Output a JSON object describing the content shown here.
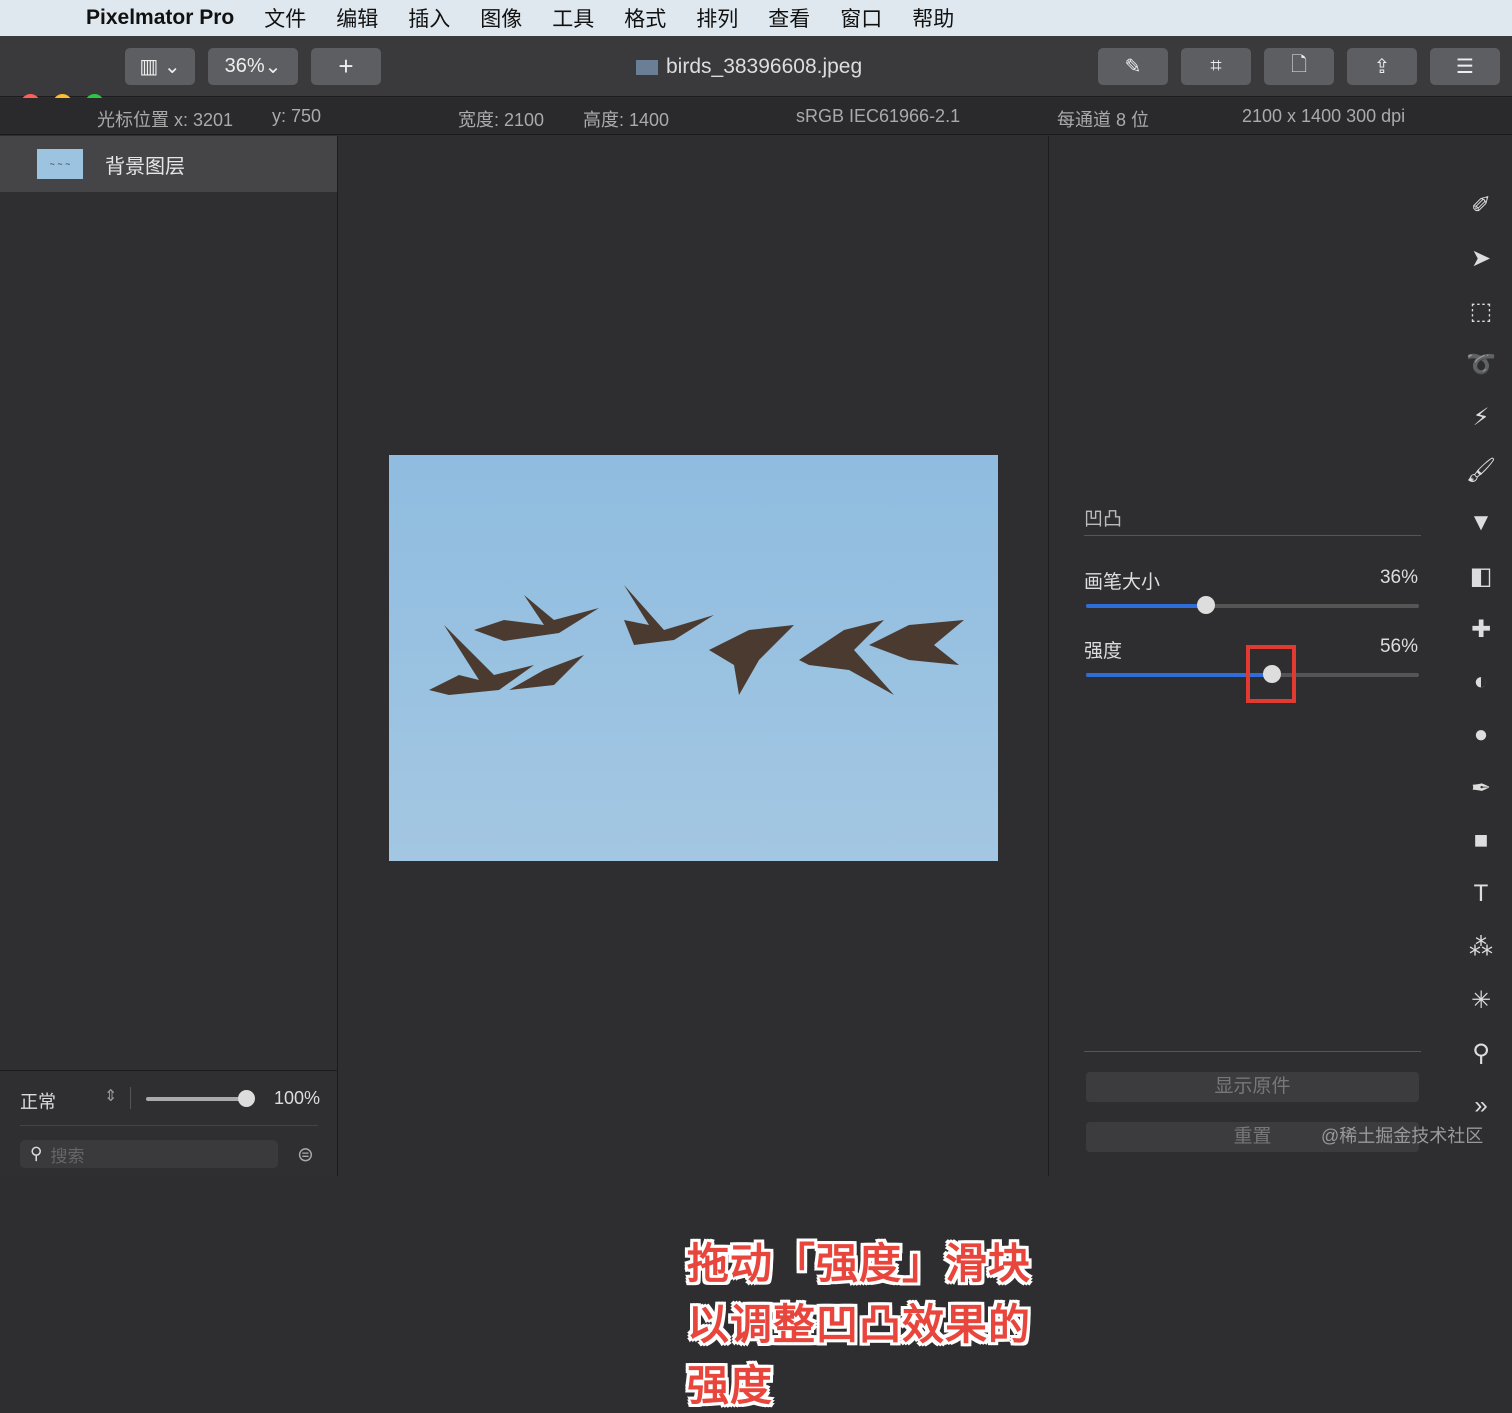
{
  "menubar": {
    "app": "Pixelmator Pro",
    "items": [
      "文件",
      "编辑",
      "插入",
      "图像",
      "工具",
      "格式",
      "排列",
      "查看",
      "窗口",
      "帮助"
    ]
  },
  "toolbar": {
    "zoom": "36%",
    "add": "+",
    "document_title": "birds_38396608.jpeg",
    "traffic_colors": [
      "#fe5f57",
      "#febc2e",
      "#28c840"
    ]
  },
  "infobar": {
    "cursor_label": "光标位置 x: 3201",
    "cursor_y": "y: 750",
    "width": "宽度: 2100",
    "height": "高度: 1400",
    "color_profile": "sRGB IEC61966-2.1",
    "bit_depth": "每通道 8 位",
    "dimensions": "2100 x 1400 300 dpi"
  },
  "layers": {
    "items": [
      {
        "name": "背景图层"
      }
    ],
    "blend_mode": "正常",
    "opacity": "100%",
    "opacity_value": 100,
    "search_placeholder": "搜索"
  },
  "effect": {
    "title": "凹凸",
    "brush_size_label": "画笔大小",
    "brush_size": "36%",
    "brush_size_value": 36,
    "strength_label": "强度",
    "strength": "56%",
    "strength_value": 56,
    "show_original": "显示原件",
    "reset": "重置",
    "accent": "#2f6ed8",
    "highlight": "#e03a32"
  },
  "tools": [
    "paint-bucket-style",
    "arrow",
    "selection",
    "lasso",
    "magic-wand",
    "brush",
    "fill",
    "eraser",
    "repair",
    "clone",
    "blur",
    "pen",
    "shape",
    "text",
    "color-adjust",
    "distort",
    "zoom",
    "more"
  ],
  "caption": "拖动「强度」滑块以调整凹凸效果的强度",
  "watermark": "@稀土掘金技术社区"
}
